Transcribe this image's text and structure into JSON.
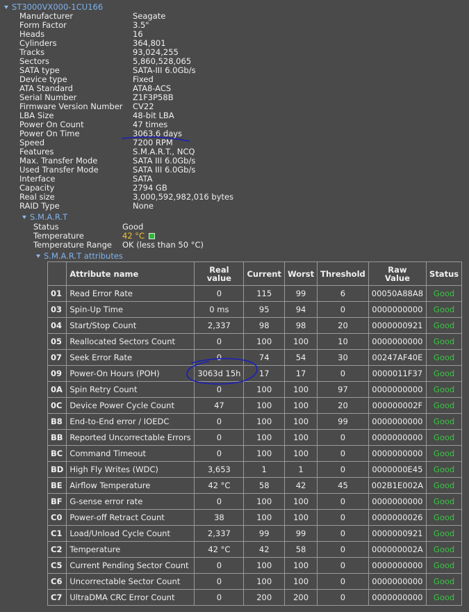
{
  "drive": {
    "name": "ST3000VX000-1CU166",
    "properties": [
      {
        "label": "Manufacturer",
        "value": "Seagate"
      },
      {
        "label": "Form Factor",
        "value": "3.5\""
      },
      {
        "label": "Heads",
        "value": "16"
      },
      {
        "label": "Cylinders",
        "value": "364,801"
      },
      {
        "label": "Tracks",
        "value": "93,024,255"
      },
      {
        "label": "Sectors",
        "value": "5,860,528,065"
      },
      {
        "label": "SATA type",
        "value": "SATA-III 6.0Gb/s"
      },
      {
        "label": "Device type",
        "value": "Fixed"
      },
      {
        "label": "ATA Standard",
        "value": "ATA8-ACS"
      },
      {
        "label": "Serial Number",
        "value": "Z1F3P58B"
      },
      {
        "label": "Firmware Version Number",
        "value": "CV22"
      },
      {
        "label": "LBA Size",
        "value": "48-bit LBA"
      },
      {
        "label": "Power On Count",
        "value": "47 times"
      },
      {
        "label": "Power On Time",
        "value": "3063.6 days"
      },
      {
        "label": "Speed",
        "value": "7200 RPM"
      },
      {
        "label": "Features",
        "value": "S.M.A.R.T., NCQ"
      },
      {
        "label": "Max. Transfer Mode",
        "value": "SATA III 6.0Gb/s"
      },
      {
        "label": "Used Transfer Mode",
        "value": "SATA III 6.0Gb/s"
      },
      {
        "label": "Interface",
        "value": "SATA"
      },
      {
        "label": "Capacity",
        "value": "2794 GB"
      },
      {
        "label": "Real size",
        "value": "3,000,592,982,016 bytes"
      },
      {
        "label": "RAID Type",
        "value": "None"
      }
    ]
  },
  "smart": {
    "title": "S.M.A.R.T",
    "status_label": "Status",
    "status_value": "Good",
    "temperature_label": "Temperature",
    "temperature_value": "42 °C",
    "temperature_range_label": "Temperature Range",
    "temperature_range_value": "OK (less than 50 °C)",
    "attributes_title": "S.M.A.R.T attributes",
    "columns": {
      "name": "Attribute name",
      "real_line1": "Real",
      "real_line2": "value",
      "current": "Current",
      "worst": "Worst",
      "threshold": "Threshold",
      "raw_line1": "Raw",
      "raw_line2": "Value",
      "status": "Status"
    },
    "attributes": [
      {
        "id": "01",
        "name": "Read Error Rate",
        "real": "0",
        "current": "115",
        "worst": "99",
        "threshold": "6",
        "raw": "00050A88A8",
        "status": "Good"
      },
      {
        "id": "03",
        "name": "Spin-Up Time",
        "real": "0 ms",
        "current": "95",
        "worst": "94",
        "threshold": "0",
        "raw": "0000000000",
        "status": "Good"
      },
      {
        "id": "04",
        "name": "Start/Stop Count",
        "real": "2,337",
        "current": "98",
        "worst": "98",
        "threshold": "20",
        "raw": "0000000921",
        "status": "Good"
      },
      {
        "id": "05",
        "name": "Reallocated Sectors Count",
        "real": "0",
        "current": "100",
        "worst": "100",
        "threshold": "10",
        "raw": "0000000000",
        "status": "Good"
      },
      {
        "id": "07",
        "name": "Seek Error Rate",
        "real": "0",
        "current": "74",
        "worst": "54",
        "threshold": "30",
        "raw": "00247AF40E",
        "status": "Good"
      },
      {
        "id": "09",
        "name": "Power-On Hours (POH)",
        "real": "3063d 15h",
        "current": "17",
        "worst": "17",
        "threshold": "0",
        "raw": "0000011F37",
        "status": "Good"
      },
      {
        "id": "0A",
        "name": "Spin Retry Count",
        "real": "0",
        "current": "100",
        "worst": "100",
        "threshold": "97",
        "raw": "0000000000",
        "status": "Good"
      },
      {
        "id": "0C",
        "name": "Device Power Cycle Count",
        "real": "47",
        "current": "100",
        "worst": "100",
        "threshold": "20",
        "raw": "000000002F",
        "status": "Good"
      },
      {
        "id": "B8",
        "name": "End-to-End error / IOEDC",
        "real": "0",
        "current": "100",
        "worst": "100",
        "threshold": "99",
        "raw": "0000000000",
        "status": "Good"
      },
      {
        "id": "BB",
        "name": "Reported Uncorrectable Errors",
        "real": "0",
        "current": "100",
        "worst": "100",
        "threshold": "0",
        "raw": "0000000000",
        "status": "Good"
      },
      {
        "id": "BC",
        "name": "Command Timeout",
        "real": "0",
        "current": "100",
        "worst": "100",
        "threshold": "0",
        "raw": "0000000000",
        "status": "Good"
      },
      {
        "id": "BD",
        "name": "High Fly Writes (WDC)",
        "real": "3,653",
        "current": "1",
        "worst": "1",
        "threshold": "0",
        "raw": "0000000E45",
        "status": "Good"
      },
      {
        "id": "BE",
        "name": "Airflow Temperature",
        "real": "42 °C",
        "current": "58",
        "worst": "42",
        "threshold": "45",
        "raw": "002B1E002A",
        "status": "Good"
      },
      {
        "id": "BF",
        "name": "G-sense error rate",
        "real": "0",
        "current": "100",
        "worst": "100",
        "threshold": "0",
        "raw": "0000000000",
        "status": "Good"
      },
      {
        "id": "C0",
        "name": "Power-off Retract Count",
        "real": "38",
        "current": "100",
        "worst": "100",
        "threshold": "0",
        "raw": "0000000026",
        "status": "Good"
      },
      {
        "id": "C1",
        "name": "Load/Unload Cycle Count",
        "real": "2,337",
        "current": "99",
        "worst": "99",
        "threshold": "0",
        "raw": "0000000921",
        "status": "Good"
      },
      {
        "id": "C2",
        "name": "Temperature",
        "real": "42 °C",
        "current": "42",
        "worst": "58",
        "threshold": "0",
        "raw": "000000002A",
        "status": "Good"
      },
      {
        "id": "C5",
        "name": "Current Pending Sector Count",
        "real": "0",
        "current": "100",
        "worst": "100",
        "threshold": "0",
        "raw": "0000000000",
        "status": "Good"
      },
      {
        "id": "C6",
        "name": "Uncorrectable Sector Count",
        "real": "0",
        "current": "100",
        "worst": "100",
        "threshold": "0",
        "raw": "0000000000",
        "status": "Good"
      },
      {
        "id": "C7",
        "name": "UltraDMA CRC Error Count",
        "real": "0",
        "current": "200",
        "worst": "200",
        "threshold": "0",
        "raw": "0000000000",
        "status": "Good"
      }
    ]
  },
  "annotation_color": "#1a1fb8",
  "status_good_color": "#35c83d"
}
